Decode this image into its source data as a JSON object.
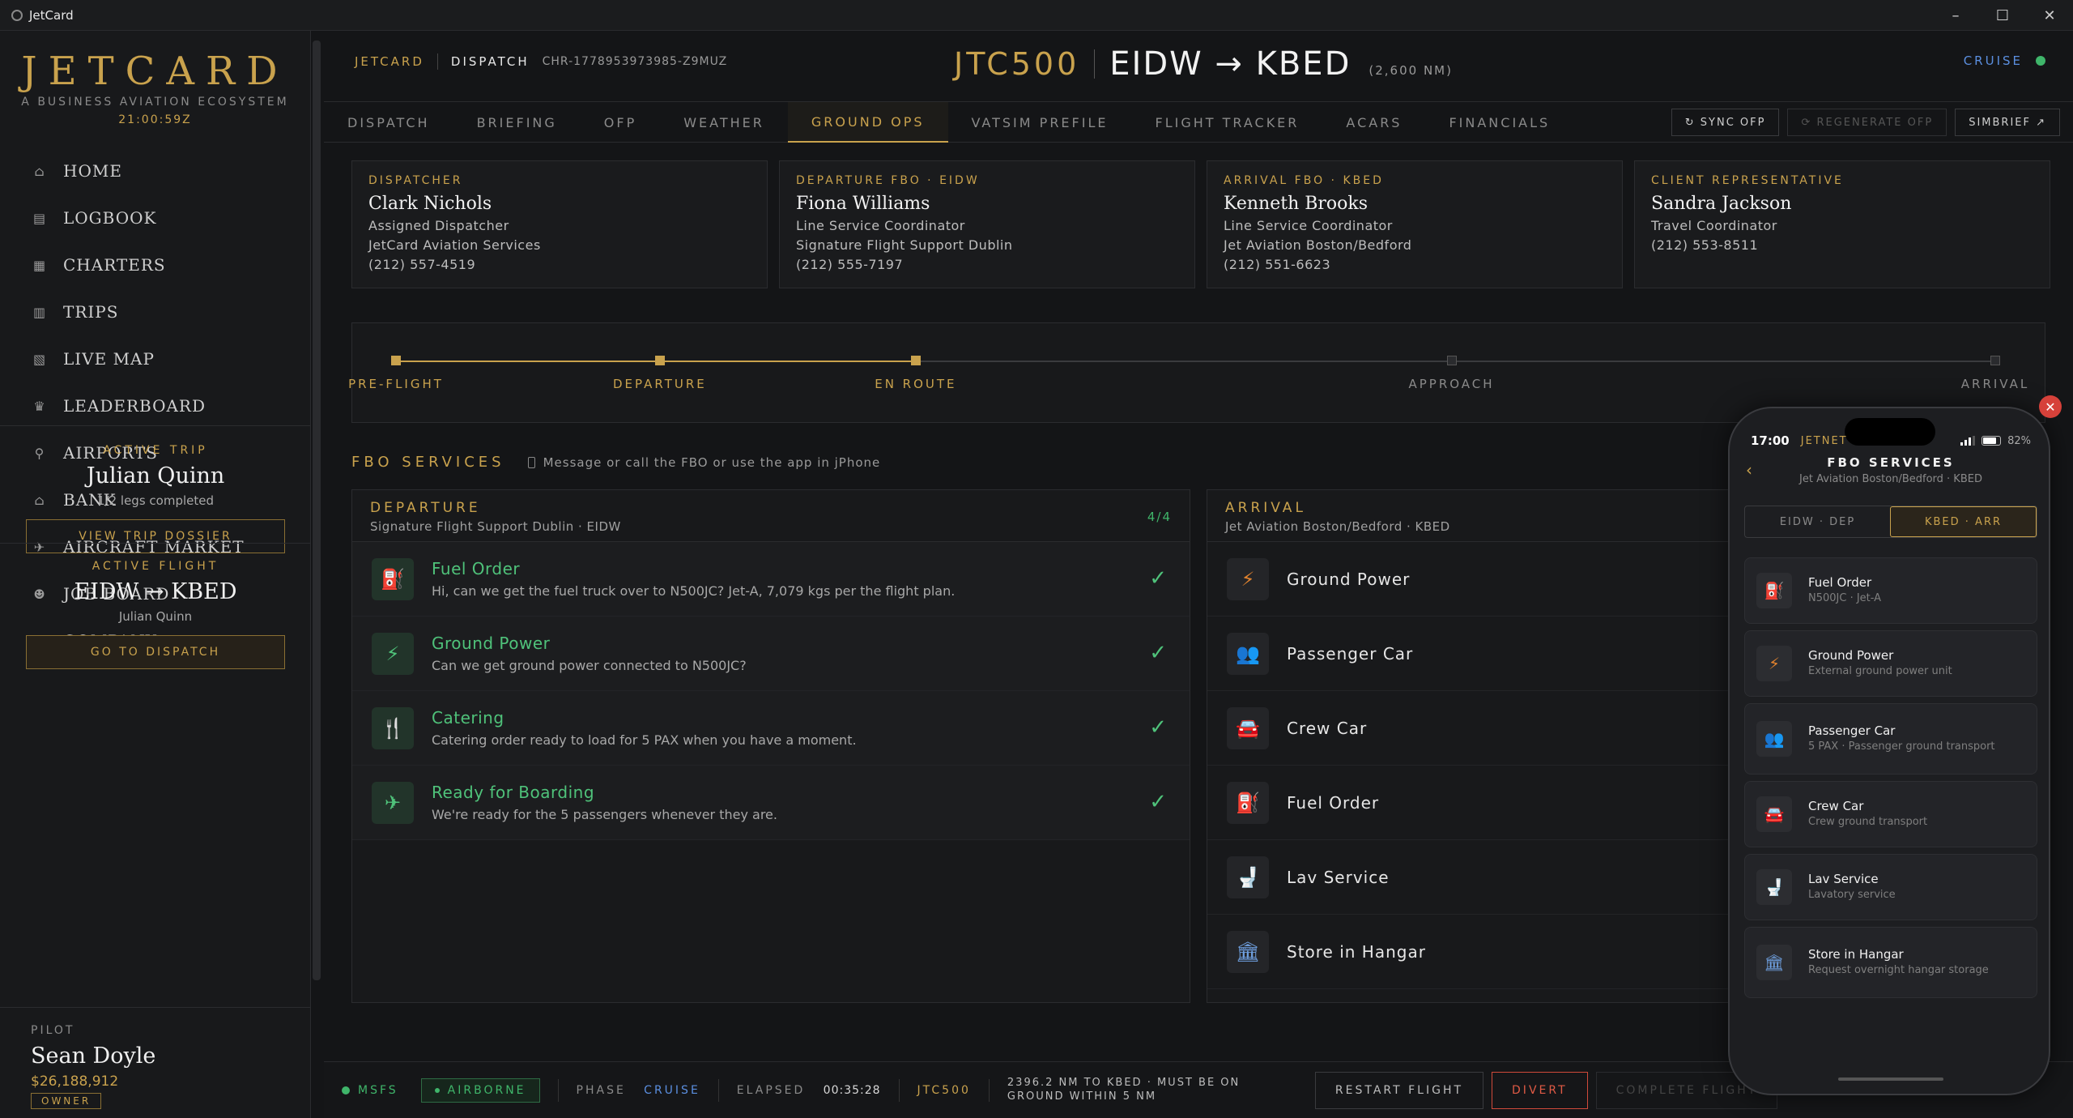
{
  "window": {
    "title": "JetCard",
    "controls": [
      "–",
      "☐",
      "✕"
    ]
  },
  "brand": {
    "logo": "JETCARD",
    "tagline": "A BUSINESS AVIATION ECOSYSTEM",
    "clock": "21:00:59Z"
  },
  "nav": [
    {
      "label": "HOME",
      "icon": "home-icon",
      "glyph": "⌂"
    },
    {
      "label": "LOGBOOK",
      "icon": "book-icon",
      "glyph": "▤"
    },
    {
      "label": "CHARTERS",
      "icon": "calendar-icon",
      "glyph": "▦"
    },
    {
      "label": "TRIPS",
      "icon": "luggage-icon",
      "glyph": "▥"
    },
    {
      "label": "LIVE MAP",
      "icon": "map-icon",
      "glyph": "▧"
    },
    {
      "label": "LEADERBOARD",
      "icon": "trophy-icon",
      "glyph": "♛"
    },
    {
      "label": "AIRPORTS",
      "icon": "location-pin-icon",
      "glyph": "⚲"
    },
    {
      "label": "BANK",
      "icon": "bank-icon",
      "glyph": "⌂"
    },
    {
      "label": "AIRCRAFT MARKET",
      "icon": "plane-icon",
      "glyph": "✈"
    },
    {
      "label": "JOB BOARD",
      "icon": "person-icon",
      "glyph": "☻"
    },
    {
      "label": "COMPANY",
      "icon": "building-icon",
      "glyph": "▮"
    }
  ],
  "active_trip": {
    "label": "ACTIVE TRIP",
    "name": "Julian Quinn",
    "legs": "1/2 legs completed",
    "button": "VIEW TRIP DOSSIER"
  },
  "active_flight": {
    "label": "ACTIVE FLIGHT",
    "route": "EIDW → KBED",
    "pax": "Julian Quinn",
    "button": "GO TO DISPATCH"
  },
  "pilot": {
    "label": "PILOT",
    "name": "Sean Doyle",
    "balance": "$26,188,912",
    "role": "OWNER"
  },
  "header": {
    "crumb1": "JETCARD",
    "crumb2": "DISPATCH",
    "charter_id": "CHR-1778953973985-Z9MUZ",
    "callsign": "JTC500",
    "route": "EIDW → KBED",
    "distance": "(2,600 NM)",
    "phase": "CRUISE"
  },
  "tabs": [
    "DISPATCH",
    "BRIEFING",
    "OFP",
    "WEATHER",
    "GROUND OPS",
    "VATSIM PREFILE",
    "FLIGHT TRACKER",
    "ACARS",
    "FINANCIALS"
  ],
  "active_tab": "GROUND OPS",
  "tab_buttons": {
    "sync": "↻ SYNC OFP",
    "regenerate": "⟳ REGENERATE OFP",
    "simbrief": "SIMBRIEF ↗"
  },
  "contacts": [
    {
      "role": "DISPATCHER",
      "name": "Clark Nichols",
      "lines": [
        "Assigned Dispatcher",
        "JetCard Aviation Services",
        "(212) 557-4519"
      ]
    },
    {
      "role": "DEPARTURE FBO · EIDW",
      "name": "Fiona Williams",
      "lines": [
        "Line Service Coordinator",
        "Signature Flight Support Dublin",
        "(212) 555-7197"
      ]
    },
    {
      "role": "ARRIVAL FBO · KBED",
      "name": "Kenneth Brooks",
      "lines": [
        "Line Service Coordinator",
        "Jet Aviation Boston/Bedford",
        "(212) 551-6623"
      ]
    },
    {
      "role": "CLIENT REPRESENTATIVE",
      "name": "Sandra Jackson",
      "lines": [
        "Travel Coordinator",
        "(212) 553-8511",
        ""
      ]
    }
  ],
  "progress": {
    "completed_fraction": 0.325,
    "stages": [
      {
        "label": "PRE-FLIGHT",
        "done": true
      },
      {
        "label": "DEPARTURE",
        "done": true
      },
      {
        "label": "EN ROUTE",
        "done": true
      },
      {
        "label": "APPROACH",
        "done": false
      },
      {
        "label": "ARRIVAL",
        "done": false
      }
    ]
  },
  "fbo": {
    "title": "FBO SERVICES",
    "hint": "Message or call the FBO or use the app in jPhone",
    "departure": {
      "title": "DEPARTURE",
      "subtitle": "Signature Flight Support Dublin · EIDW",
      "count": "4/4",
      "services": [
        {
          "title": "Fuel Order",
          "desc": "Hi, can we get the fuel truck over to N500JC? Jet-A, 7,079 kgs per the flight plan.",
          "icon": "fuel-pump-icon",
          "glyph": "⛽"
        },
        {
          "title": "Ground Power",
          "desc": "Can we get ground power connected to N500JC?",
          "icon": "lightning-icon",
          "glyph": "⚡"
        },
        {
          "title": "Catering",
          "desc": "Catering order ready to load for 5 PAX when you have a moment.",
          "icon": "utensils-icon",
          "glyph": "🍴"
        },
        {
          "title": "Ready for Boarding",
          "desc": "We're ready for the 5 passengers whenever they are.",
          "icon": "plane-departure-icon",
          "glyph": "✈"
        }
      ]
    },
    "arrival": {
      "title": "ARRIVAL",
      "subtitle": "Jet Aviation Boston/Bedford · KBED",
      "services": [
        {
          "title": "Ground Power",
          "icon": "lightning-icon",
          "glyph": "⚡",
          "color": "#e0822e"
        },
        {
          "title": "Passenger Car",
          "icon": "people-icon",
          "glyph": "👥",
          "color": "#d8b03a"
        },
        {
          "title": "Crew Car",
          "icon": "car-icon",
          "glyph": "🚘",
          "color": "#4f8fe0"
        },
        {
          "title": "Fuel Order",
          "icon": "fuel-pump-icon",
          "glyph": "⛽",
          "color": "#d6413a"
        },
        {
          "title": "Lav Service",
          "icon": "toilet-icon",
          "glyph": "🚽",
          "color": "#8a8a8a"
        },
        {
          "title": "Store in Hangar",
          "icon": "hangar-icon",
          "glyph": "🏛",
          "color": "#6fa0e0"
        }
      ]
    }
  },
  "phone": {
    "time": "17:00",
    "carrier": "JETNET",
    "battery": "82%",
    "title": "FBO SERVICES",
    "subtitle": "Jet Aviation Boston/Bedford · KBED",
    "seg_dep": "EIDW · DEP",
    "seg_arr": "KBED · ARR",
    "cards": [
      {
        "title": "Fuel Order",
        "desc": "N500JC · Jet-A",
        "icon": "fuel-pump-icon",
        "glyph": "⛽",
        "color": "#d6413a"
      },
      {
        "title": "Ground Power",
        "desc": "External ground power unit",
        "icon": "lightning-icon",
        "glyph": "⚡",
        "color": "#e0822e"
      },
      {
        "title": "Passenger Car",
        "desc": "5 PAX · Passenger ground transport",
        "icon": "people-icon",
        "glyph": "👥",
        "color": "#d8b03a"
      },
      {
        "title": "Crew Car",
        "desc": "Crew ground transport",
        "icon": "car-icon",
        "glyph": "🚘",
        "color": "#4f8fe0"
      },
      {
        "title": "Lav Service",
        "desc": "Lavatory service",
        "icon": "toilet-icon",
        "glyph": "🚽",
        "color": "#8a8a8a"
      },
      {
        "title": "Store in Hangar",
        "desc": "Request overnight hangar storage",
        "icon": "hangar-icon",
        "glyph": "🏛",
        "color": "#6fa0e0"
      }
    ]
  },
  "bottom": {
    "sim": "MSFS",
    "status": "AIRBORNE",
    "phase_label": "PHASE",
    "phase": "CRUISE",
    "elapsed_label": "ELAPSED",
    "elapsed": "00:35:28",
    "callsign": "JTC500",
    "distance_note": "2396.2 NM TO KBED · MUST BE ON GROUND WITHIN 5 NM",
    "restart": "RESTART FLIGHT",
    "divert": "DIVERT",
    "complete": "COMPLETE FLIGHT"
  }
}
